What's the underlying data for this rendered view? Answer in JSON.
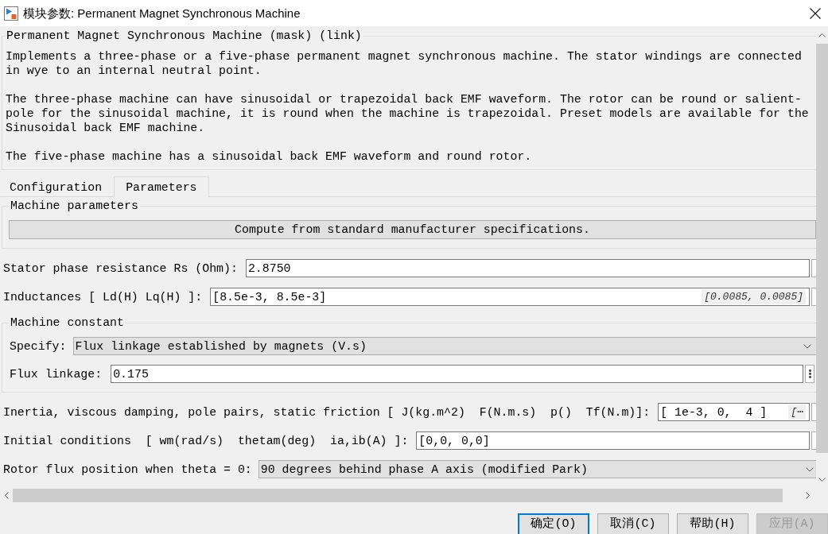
{
  "window": {
    "title": "模块参数: Permanent Magnet Synchronous Machine"
  },
  "description": {
    "title": "Permanent Magnet Synchronous Machine (mask) (link)",
    "paragraphs": [
      "Implements a three-phase or a five-phase permanent magnet synchronous machine. The stator windings are connected in wye to an internal neutral point.",
      "The three-phase machine can have sinusoidal or trapezoidal back EMF waveform. The rotor can be round or salient-pole for the sinusoidal machine, it is round when the machine is trapezoidal. Preset models are available for the Sinusoidal back EMF machine.",
      "The five-phase machine has a sinusoidal back EMF waveform and round rotor."
    ]
  },
  "tabs": [
    {
      "label": "Configuration",
      "selected": false
    },
    {
      "label": "Parameters",
      "selected": true
    }
  ],
  "parameters": [
    {
      "kind": "group",
      "title": "Machine parameters",
      "children": [
        {
          "kind": "button",
          "label": "Compute from standard manufacturer specifications."
        }
      ]
    },
    {
      "kind": "field",
      "label": "Stator phase resistance Rs (Ohm):",
      "value": "2.8750"
    },
    {
      "kind": "field",
      "label": "Inductances [ Ld(H) Lq(H) ]:",
      "value": "[8.5e-3, 8.5e-3]",
      "evaluated": "[0.0085, 0.0085]"
    },
    {
      "kind": "group",
      "title": "Machine constant",
      "children": [
        {
          "kind": "dropdown",
          "label": "Specify:",
          "value": "Flux linkage established by magnets (V.s)"
        },
        {
          "kind": "field",
          "label": "Flux linkage:",
          "value": "0.175"
        }
      ]
    },
    {
      "kind": "field",
      "label": "Inertia, viscous damping, pole pairs, static friction [ J(kg.m^2)  F(N.m.s)  p()  Tf(N.m)]:",
      "value": "[ 1e-3, 0,  4 ]",
      "evaluated": "[⋯"
    },
    {
      "kind": "field",
      "label": "Initial conditions  [ wm(rad/s)  thetam(deg)  ia,ib(A) ]:",
      "value": "[0,0, 0,0]"
    },
    {
      "kind": "dropdown",
      "label": "Rotor flux position when theta = 0:",
      "value": "90 degrees behind phase A axis (modified Park)"
    }
  ],
  "buttons": [
    {
      "label": "确定(O)",
      "default": true,
      "disabled": false
    },
    {
      "label": "取消(C)",
      "default": false,
      "disabled": false
    },
    {
      "label": "帮助(H)",
      "default": false,
      "disabled": false
    },
    {
      "label": "应用(A)",
      "default": false,
      "disabled": true
    }
  ]
}
